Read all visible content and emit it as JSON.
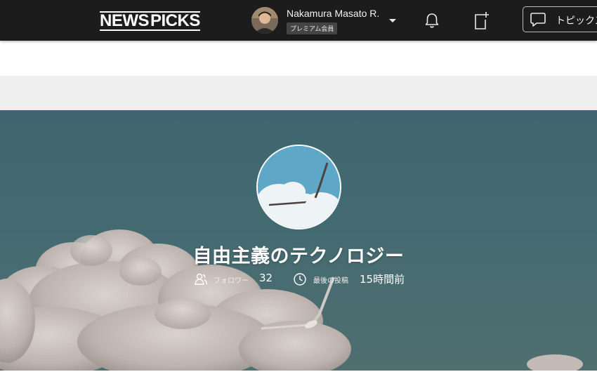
{
  "header": {
    "logo_word1": "NEWS",
    "logo_word2": "PICKS",
    "user_name": "Nakamura Masato R.",
    "user_badge": "プレミアム会員",
    "topic_button_label": "トピックス",
    "colors": {
      "bar_bg": "#1c1c1c",
      "text": "#ffffff"
    },
    "icons": [
      "avatar",
      "chevron-down-icon",
      "bell-icon",
      "new-post-icon",
      "chat-bubble-icon"
    ]
  },
  "topic": {
    "title": "自由主義のテクノロジー",
    "followers_label": "フォロワー",
    "followers_count": "32",
    "last_post_label": "最後の投稿",
    "last_post_value": "15時間前",
    "icons": [
      "followers-icon",
      "clock-icon"
    ],
    "colors": {
      "hero_bg": "#446a71"
    }
  }
}
